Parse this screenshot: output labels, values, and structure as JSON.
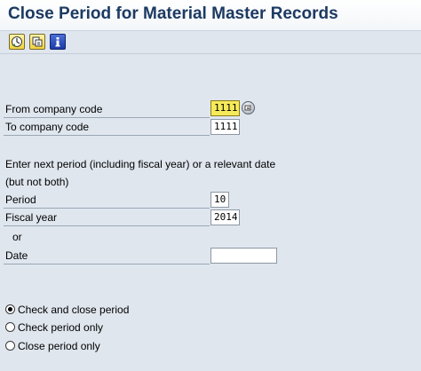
{
  "title": "Close Period for Material Master Records",
  "toolbar": {
    "buttons": [
      {
        "icon": "execute-icon"
      },
      {
        "icon": "variant-icon"
      },
      {
        "icon": "info-icon"
      }
    ]
  },
  "form": {
    "from_company_label": "From company code",
    "from_company_value": "1111",
    "to_company_label": "To company code",
    "to_company_value": "1111",
    "instruction_line1": "Enter next period (including fiscal year) or a relevant date",
    "instruction_line2": "(but not both)",
    "period_label": "Period",
    "period_value": "10",
    "fiscal_year_label": "Fiscal year",
    "fiscal_year_value": "2014",
    "or_label": "or",
    "date_label": "Date",
    "date_value": ""
  },
  "options": [
    {
      "label": "Check and close period",
      "selected": true
    },
    {
      "label": "Check period only",
      "selected": false
    },
    {
      "label": "Close period only",
      "selected": false
    }
  ],
  "colors": {
    "title": "#1c3a62",
    "background": "#dfe6ee",
    "active_field": "#f6ea5a"
  }
}
